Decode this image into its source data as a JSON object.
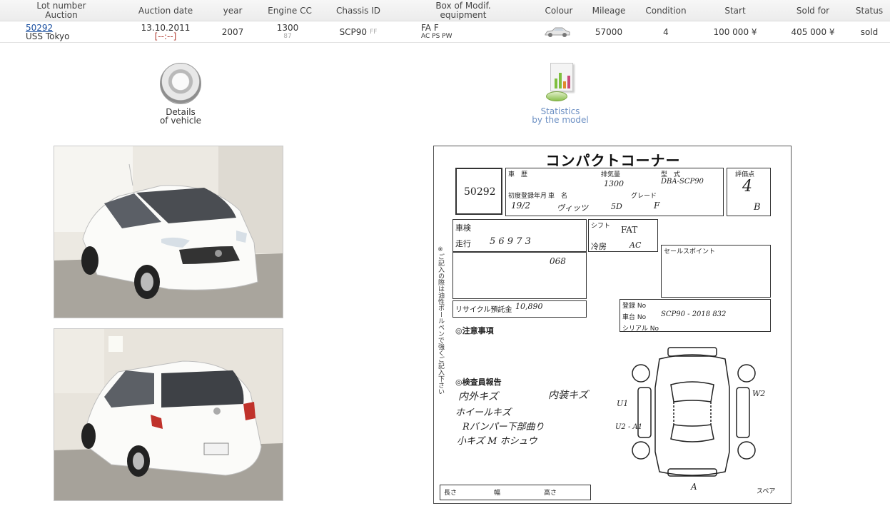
{
  "header": {
    "lot_auction": "Lot number\nAuction",
    "auction_date": "Auction date",
    "year": "year",
    "engine_cc": "Engine CC",
    "chassis_id": "Chassis ID",
    "box_modif": "Box of Modif.\nequipment",
    "colour": "Colour",
    "mileage": "Mileage",
    "condition": "Condition",
    "start": "Start",
    "sold_for": "Sold for",
    "status": "Status"
  },
  "lot": {
    "number": "50292",
    "auction": "USS Tokyo",
    "date": "13.10.2011",
    "time": "[--:--]",
    "year": "2007",
    "engine_cc": "1300",
    "engine_sub": "87",
    "chassis": "SCP90",
    "chassis_sub": "FF",
    "box": "FA F",
    "equipment": "AC PS PW",
    "mileage": "57000",
    "condition": "4",
    "start": "100 000 ¥",
    "sold_for": "405 000 ¥",
    "status": "sold"
  },
  "actions": {
    "details_line1": "Details",
    "details_line2": "of vehicle",
    "stats_line1": "Statistics",
    "stats_line2": "by the model"
  },
  "icons": {
    "colour": "car-silhouette-icon",
    "details": "steering-wheel-icon",
    "stats": "statistics-chart-icon"
  },
  "colors": {
    "link": "#1a4fa0",
    "year": "#b03a2e",
    "condition": "#b03a2e",
    "stats_label": "#6b8fc3"
  },
  "sheet": {
    "title": "コンパクトコーナー",
    "lot_number": "50292",
    "hw_displacement": "1300",
    "hw_model": "DBA-SCP90",
    "hw_first_reg": "19/2",
    "hw_name": "ヴィッツ",
    "hw_doors": "5D",
    "hw_grade": "F",
    "hw_mileage": "5 6 9 7 3",
    "hw_shift": "FAT",
    "hw_ac": "AC",
    "hw_colour": "068",
    "hw_recycle": "10,890",
    "hw_chassis_no": "SCP90 - 2018 832",
    "hw_score": "4",
    "hw_interior": "B",
    "hw_notes_1": "内外キズ",
    "hw_notes_2": "ホイールキズ",
    "hw_notes_3": "Rバンパー下部曲り",
    "hw_notes_4": "小キズ M ホシュウ",
    "hw_notes_5": "内装キズ",
    "hw_label_u1": "U1",
    "hw_label_u2": "U2 - A1",
    "hw_label_w": "W2",
    "hw_size_a": "A",
    "lbl_vehicle_history": "車　歴",
    "lbl_displacement": "排気量",
    "lbl_model": "型　式",
    "lbl_score": "評価点",
    "lbl_first_reg": "初度登録年月",
    "lbl_car_name": "車　名",
    "lbl_grade": "グレード",
    "lbl_inspection": "車検",
    "lbl_run": "走行",
    "lbl_shift": "シフト",
    "lbl_ac": "冷房",
    "lbl_sales_point": "セールスポイント",
    "lbl_recycle": "リサイクル預託金",
    "lbl_notes": "◎注意事項",
    "lbl_inspector": "◎検査員報告",
    "lbl_chassis_no": "車台 No",
    "lbl_serial_no": "シリアル No",
    "lbl_reg_no": "登録 No",
    "lbl_length": "長さ",
    "lbl_width": "幅",
    "lbl_height": "高さ",
    "lbl_spare": "スペア",
    "vertical_note": "※ご記入の際は油性ボールペンで強くご記入下さい"
  }
}
